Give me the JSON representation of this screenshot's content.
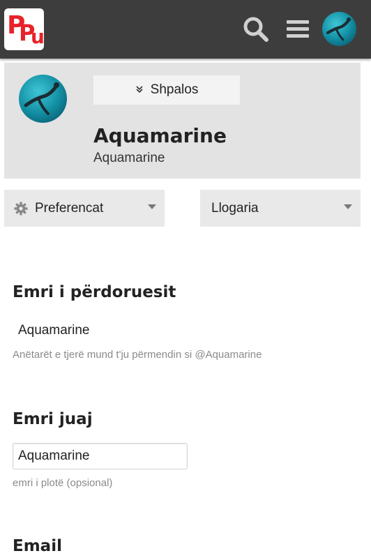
{
  "header": {
    "logo_text": "PPu",
    "logo_letters": [
      "P",
      "P",
      "u"
    ],
    "icons": [
      "search-icon",
      "hamburger-menu-icon",
      "user-avatar"
    ]
  },
  "profile": {
    "expand_label": "Shpalos",
    "display_name": "Aquamarine",
    "username": "Aquamarine"
  },
  "dropdowns": {
    "preferences": "Preferencat",
    "account": "Llogaria"
  },
  "username_section": {
    "title": "Emri i përdoruesit",
    "value": "Aquamarine",
    "help": "Anëtarët e tjerë mund t'ju përmendin si @Aquamarine"
  },
  "name_section": {
    "title": "Emri juaj",
    "input_value": "Aquamarine",
    "help": "emri i plotë (opsional)"
  },
  "email_section": {
    "title": "Email"
  },
  "colors": {
    "topbar": "#3d3d3d",
    "logo_red": "#e8222a",
    "card_bg": "#e3e3e3",
    "dropdown_bg": "#e9e9e9",
    "help_text": "#8a8a8a"
  }
}
